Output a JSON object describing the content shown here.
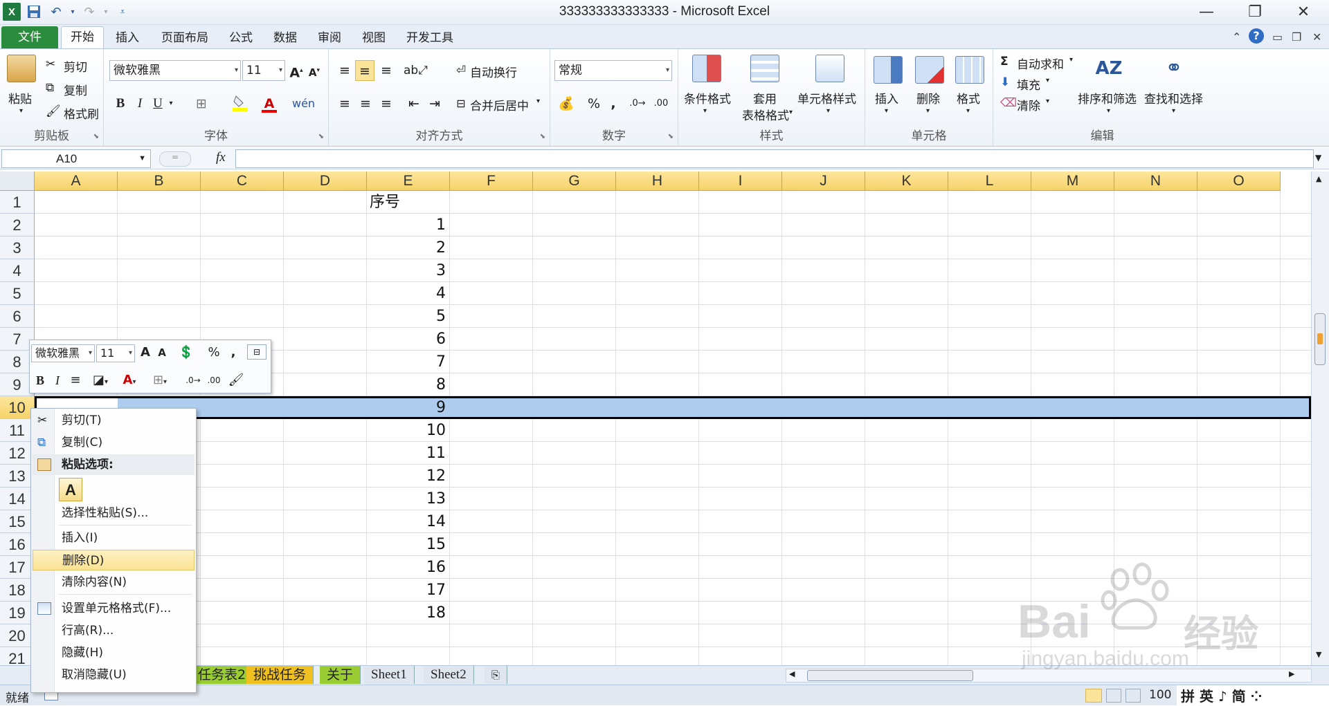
{
  "window": {
    "title": "333333333333333 - Microsoft Excel",
    "controls": [
      "minimize-icon",
      "restore-icon",
      "close-icon"
    ]
  },
  "quick_access": [
    "excel-logo-icon",
    "save-icon",
    "undo-icon",
    "redo-icon",
    "customize-icon"
  ],
  "tabs": {
    "file": "文件",
    "items": [
      "开始",
      "插入",
      "页面布局",
      "公式",
      "数据",
      "审阅",
      "视图",
      "开发工具"
    ],
    "active": "开始"
  },
  "ribbon": {
    "clipboard": {
      "label": "剪贴板",
      "paste": "粘贴",
      "cut": "剪切",
      "copy": "复制",
      "format_painter": "格式刷"
    },
    "font": {
      "label": "字体",
      "font_name": "微软雅黑",
      "font_size": "11",
      "bold": "B",
      "italic": "I",
      "underline": "U"
    },
    "alignment": {
      "label": "对齐方式",
      "wrap": "自动换行",
      "merge": "合并后居中"
    },
    "number": {
      "label": "数字",
      "format": "常规",
      "percent": "%",
      "comma": ","
    },
    "styles": {
      "label": "样式",
      "conditional": "条件格式",
      "table1": "套用",
      "table2": "表格格式",
      "cell_styles": "单元格样式"
    },
    "cells": {
      "label": "单元格",
      "insert": "插入",
      "delete": "删除",
      "format": "格式"
    },
    "editing": {
      "label": "编辑",
      "autosum": "自动求和",
      "fill": "填充",
      "clear": "清除",
      "sort": "排序和筛选",
      "find": "查找和选择"
    }
  },
  "formula_bar": {
    "name_box": "A10",
    "fx": "fx",
    "content": ""
  },
  "grid": {
    "columns": [
      "A",
      "B",
      "C",
      "D",
      "E",
      "F",
      "G",
      "H",
      "I",
      "J",
      "K",
      "L",
      "M",
      "N",
      "O"
    ],
    "rows": [
      "1",
      "2",
      "3",
      "4",
      "5",
      "6",
      "7",
      "8",
      "9",
      "10",
      "11",
      "12",
      "13",
      "14",
      "15",
      "16",
      "17",
      "18",
      "19",
      "20",
      "21"
    ],
    "selected_row": "10",
    "e_header": "序号",
    "e_values": [
      "1",
      "2",
      "3",
      "4",
      "5",
      "6",
      "7",
      "8",
      "9",
      "10",
      "11",
      "12",
      "13",
      "14",
      "15",
      "16",
      "17",
      "18"
    ]
  },
  "mini_toolbar": {
    "font": "微软雅黑",
    "size": "11",
    "bold": "B",
    "italic": "I",
    "percent": "%",
    "comma": ","
  },
  "context_menu": {
    "cut": "剪切(T)",
    "copy": "复制(C)",
    "paste_options": "粘贴选项:",
    "paste_a": "A",
    "paste_special": "选择性粘贴(S)...",
    "insert": "插入(I)",
    "delete": "删除(D)",
    "clear": "清除内容(N)",
    "format_cells": "设置单元格格式(F)...",
    "row_height": "行高(R)...",
    "hide": "隐藏(H)",
    "unhide": "取消隐藏(U)",
    "highlighted": "删除(D)"
  },
  "sheet_tabs": [
    "任务表2",
    "挑战任务",
    "关于",
    "Sheet1",
    "Sheet2"
  ],
  "status": {
    "ready": "就绪",
    "zoom": "100",
    "ime": "拼 英 ♪ 简 ⁘"
  },
  "watermark": {
    "brand": "Bai",
    "brand2": "经验",
    "url": "jingyan.baidu.com"
  },
  "colors": {
    "header_gold": "#f6d26a",
    "selection_blue": "#aecdee",
    "file_tab_green": "#2a8c3c",
    "menu_hot": "#fbe293"
  }
}
